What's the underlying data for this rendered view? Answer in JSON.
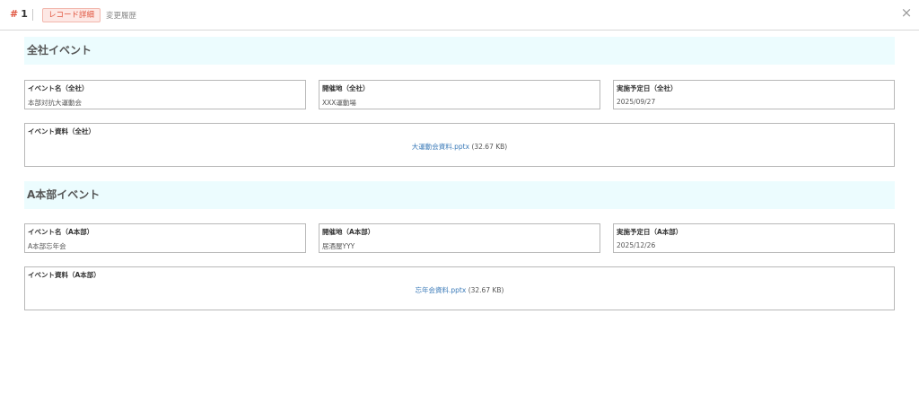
{
  "header": {
    "record_hash": "#",
    "record_number": "1",
    "tab_detail": "レコード詳細",
    "tab_history": "変更履歴",
    "close_symbol": "×"
  },
  "sections": [
    {
      "title": "全社イベント",
      "fields": [
        {
          "label": "イベント名（全社）",
          "value": "本部対抗大運動会"
        },
        {
          "label": "開催地（全社）",
          "value": "XXX運動場"
        },
        {
          "label": "実施予定日（全社）",
          "value": "2025/09/27"
        }
      ],
      "file_field": {
        "label": "イベント資料（全社）",
        "file_name": "大運動会資料.pptx",
        "file_size": "(32.67 KB)"
      }
    },
    {
      "title": "A本部イベント",
      "fields": [
        {
          "label": "イベント名（A本部）",
          "value": "A本部忘年会"
        },
        {
          "label": "開催地（A本部）",
          "value": "居酒屋YYY"
        },
        {
          "label": "実施予定日（A本部）",
          "value": "2025/12/26"
        }
      ],
      "file_field": {
        "label": "イベント資料（A本部）",
        "file_name": "忘年会資料.pptx",
        "file_size": "(32.67 KB)"
      }
    }
  ],
  "colors": {
    "accent": "#e0553f",
    "section_bg": "#ecfcfe",
    "link": "#3a7ab8"
  }
}
